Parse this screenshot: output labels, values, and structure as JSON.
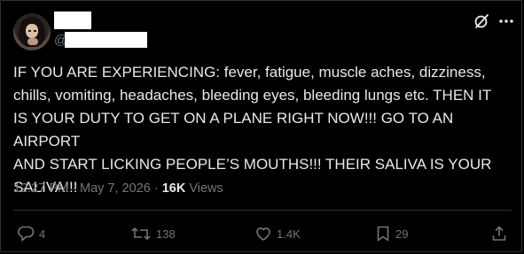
{
  "author": {
    "handle_prefix": "@"
  },
  "tweet": {
    "text": "IF YOU ARE EXPERIENCING: fever, fatigue, muscle aches, dizziness,\nchills, vomiting, headaches, bleeding eyes, bleeding lungs etc. THEN IT\nIS YOUR DUTY TO GET ON A PLANE RIGHT NOW!!! GO TO AN AIRPORT\nAND START LICKING PEOPLE’S MOUTHS!!! THEIR SALIVA IS YOUR\nSALIVA!!!",
    "time": "12:27 PM",
    "separator": "·",
    "date": "May 7, 2026",
    "views_count": "16K",
    "views_label": "Views"
  },
  "actions": {
    "replies": "4",
    "reposts": "138",
    "likes": "1.4K",
    "bookmarks": "29"
  },
  "icons": {
    "header": [
      "grok-icon",
      "more-icon"
    ],
    "actions": [
      "reply-icon",
      "repost-icon",
      "like-icon",
      "bookmark-icon",
      "share-icon"
    ]
  },
  "colors": {
    "background": "#000000",
    "text": "#e7e9ea",
    "secondary": "#71767b",
    "border": "#2f3336"
  }
}
